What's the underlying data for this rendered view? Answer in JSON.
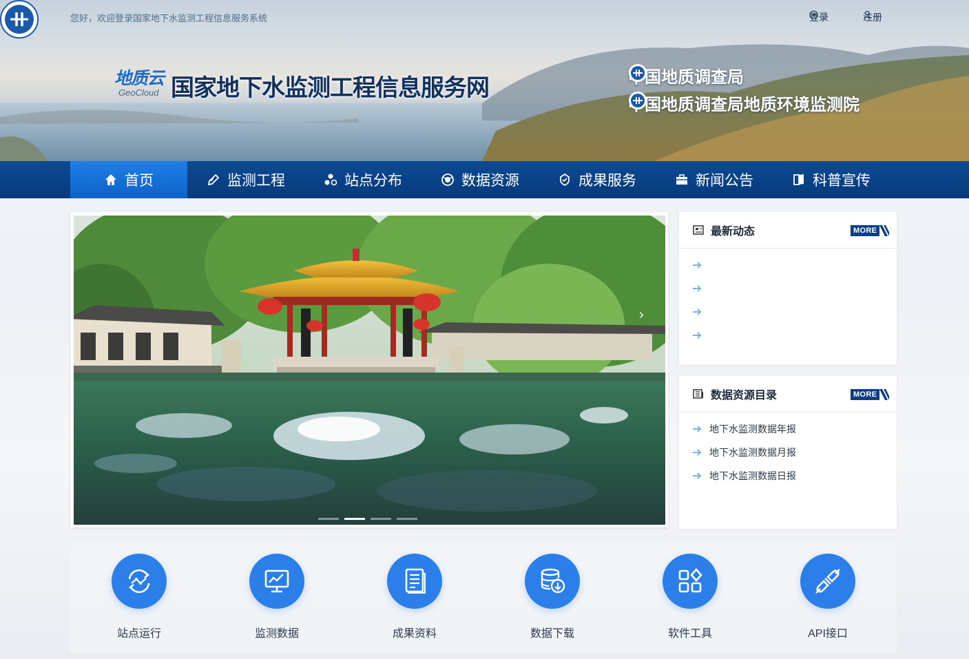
{
  "topbar": {
    "welcome": "您好，欢迎登录国家地下水监测工程信息服务系统",
    "login": "登录",
    "register": "注册"
  },
  "header": {
    "brand_cn": "地质云",
    "brand_en": "GeoCloud",
    "site_title": "国家地下水监测工程信息服务网",
    "orgs": [
      "中国地质调查局",
      "中国地质调查局地质环境监测院"
    ]
  },
  "nav": {
    "items": [
      {
        "label": "首页",
        "icon": "home-icon",
        "active": true
      },
      {
        "label": "监测工程",
        "icon": "pencil-icon"
      },
      {
        "label": "站点分布",
        "icon": "dots-icon"
      },
      {
        "label": "数据资源",
        "icon": "globe-icon"
      },
      {
        "label": "成果服务",
        "icon": "badge-icon"
      },
      {
        "label": "新闻公告",
        "icon": "briefcase-icon"
      },
      {
        "label": "科普宣传",
        "icon": "book-icon"
      }
    ]
  },
  "carousel": {
    "slides": 4,
    "active_slide": 2,
    "next_arrow": "›"
  },
  "news_panel": {
    "title": "最新动态",
    "more": "MORE",
    "items": [
      "",
      "",
      "",
      ""
    ]
  },
  "catalog_panel": {
    "title": "数据资源目录",
    "more": "MORE",
    "items": [
      "地下水监测数据年报",
      "地下水监测数据月报",
      "地下水监测数据日报"
    ]
  },
  "quick_links": [
    {
      "label": "站点运行",
      "icon": "refresh-network-icon"
    },
    {
      "label": "监测数据",
      "icon": "monitor-chart-icon"
    },
    {
      "label": "成果资料",
      "icon": "document-icon"
    },
    {
      "label": "数据下载",
      "icon": "database-download-icon"
    },
    {
      "label": "软件工具",
      "icon": "apps-icon"
    },
    {
      "label": "API接口",
      "icon": "plug-icon"
    }
  ],
  "colors": {
    "nav_bg": "#0b4488",
    "nav_active": "#1a73dc",
    "accent": "#2c7ee8",
    "more_bg": "#0b3e85"
  }
}
